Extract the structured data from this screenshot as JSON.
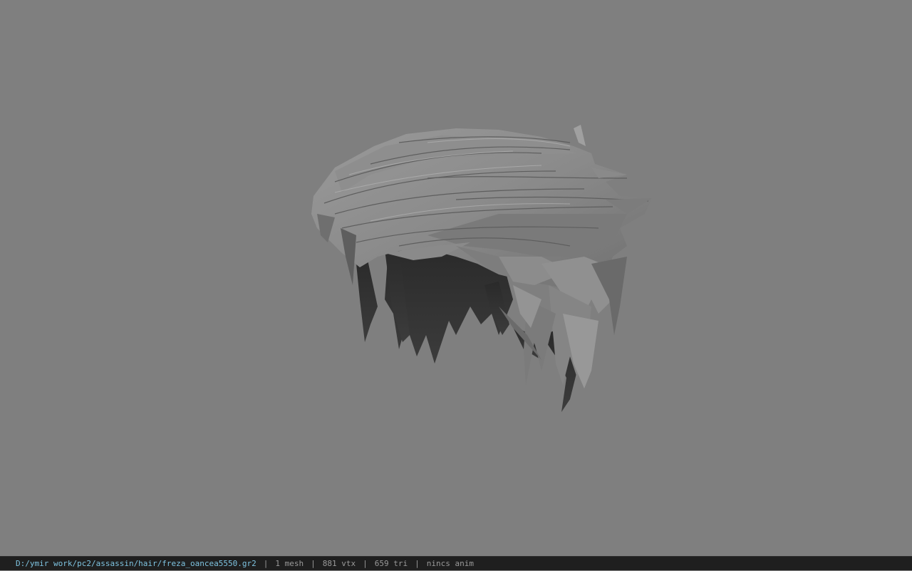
{
  "viewport": {
    "background_color": "#7f7f7f",
    "model_icon": "hair-mesh-render"
  },
  "statusbar": {
    "file_path": "D:/ymir work/pc2/assassin/hair/freza_oancea5550.gr2",
    "separator": "|",
    "mesh_count": "1 mesh",
    "vertex_count": "881 vtx",
    "triangle_count": "659 tri",
    "anim_status": "nincs anim",
    "path_color": "#7ec3e0",
    "text_color": "#9a9a9a"
  }
}
